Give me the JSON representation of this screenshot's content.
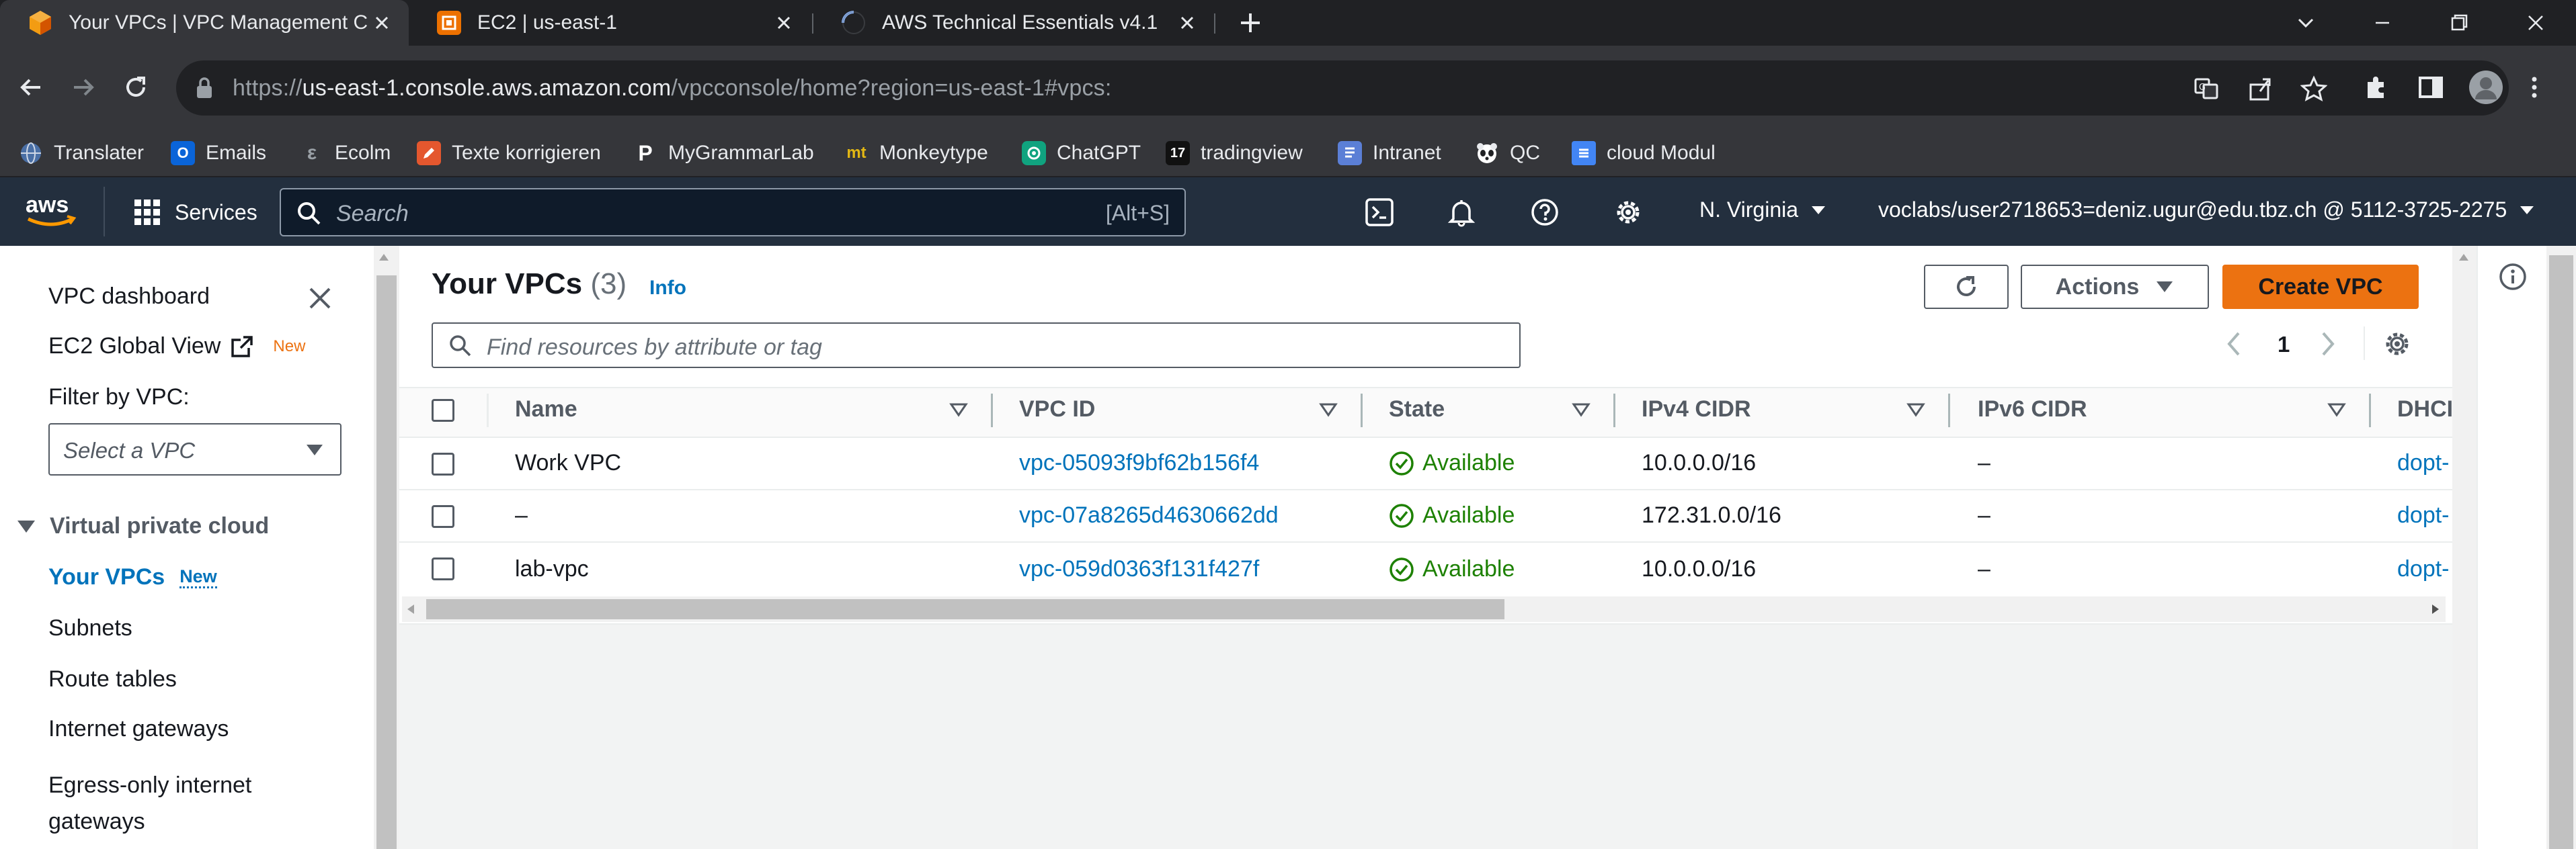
{
  "browser": {
    "tabs": [
      {
        "title": "Your VPCs | VPC Management C",
        "icon": "aws-box-icon",
        "active": true
      },
      {
        "title": "EC2 | us-east-1",
        "icon": "aws-ec2-icon",
        "active": false
      },
      {
        "title": "AWS Technical Essentials v4.1",
        "icon": "loading-spinner-icon",
        "active": false
      }
    ],
    "url": {
      "scheme": "https://",
      "host": "us-east-1.console.aws.amazon.com",
      "path": "/vpcconsole/home?region=us-east-1#vpcs:"
    },
    "bookmarks": [
      {
        "label": "Translater",
        "icon": "globe-icon",
        "color": "#4285f4"
      },
      {
        "label": "Emails",
        "icon": "outlook-icon",
        "color": "#0a64d8"
      },
      {
        "label": "Ecolm",
        "icon": "ecolm-icon",
        "color": "#6b6b6b"
      },
      {
        "label": "Texte korrigieren",
        "icon": "pencil-icon",
        "color": "#e4572e"
      },
      {
        "label": "MyGrammarLab",
        "icon": "p-icon",
        "color": "#35363a"
      },
      {
        "label": "Monkeytype",
        "icon": "mt-icon",
        "color": "#35363a"
      },
      {
        "label": "ChatGPT",
        "icon": "openai-icon",
        "color": "#10a37f"
      },
      {
        "label": "tradingview",
        "icon": "tradingview-icon",
        "color": "#111111"
      },
      {
        "label": "Intranet",
        "icon": "document-icon",
        "color": "#5b7fd6"
      },
      {
        "label": "QC",
        "icon": "panda-icon",
        "color": "#35363a"
      },
      {
        "label": "cloud Modul",
        "icon": "doc-icon",
        "color": "#4285f4"
      }
    ]
  },
  "aws_header": {
    "services_label": "Services",
    "search_placeholder": "Search",
    "search_shortcut": "[Alt+S]",
    "region": "N. Virginia",
    "account": "voclabs/user2718653=deniz.ugur@edu.tbz.ch @ 5112-3725-2275"
  },
  "sidebar": {
    "dashboard": "VPC dashboard",
    "ec2_global_view": "EC2 Global View",
    "new_badge": "New",
    "filter_label": "Filter by VPC:",
    "filter_placeholder": "Select a VPC",
    "section_title": "Virtual private cloud",
    "items": [
      {
        "label": "Your VPCs",
        "badge": "New",
        "active": true
      },
      {
        "label": "Subnets"
      },
      {
        "label": "Route tables"
      },
      {
        "label": "Internet gateways"
      },
      {
        "label": "Egress-only internet",
        "label2": "gateways"
      }
    ]
  },
  "main": {
    "title": "Your VPCs",
    "count": "(3)",
    "info": "Info",
    "actions_label": "Actions",
    "create_label": "Create VPC",
    "filter_placeholder": "Find resources by attribute or tag",
    "page": "1",
    "columns": [
      "Name",
      "VPC ID",
      "State",
      "IPv4 CIDR",
      "IPv6 CIDR",
      "DHCI"
    ],
    "rows": [
      {
        "name": "Work VPC",
        "vpc_id": "vpc-05093f9bf62b156f4",
        "state": "Available",
        "ipv4": "10.0.0.0/16",
        "ipv6": "–",
        "dhcp": "dopt-"
      },
      {
        "name": "–",
        "vpc_id": "vpc-07a8265d4630662dd",
        "state": "Available",
        "ipv4": "172.31.0.0/16",
        "ipv6": "–",
        "dhcp": "dopt-"
      },
      {
        "name": "lab-vpc",
        "vpc_id": "vpc-059d0363f131f427f",
        "state": "Available",
        "ipv4": "10.0.0.0/16",
        "ipv6": "–",
        "dhcp": "dopt-"
      }
    ]
  },
  "colors": {
    "aws_nav": "#232f3e",
    "aws_orange": "#ec7211",
    "link": "#0073bb",
    "success": "#1d8102"
  }
}
